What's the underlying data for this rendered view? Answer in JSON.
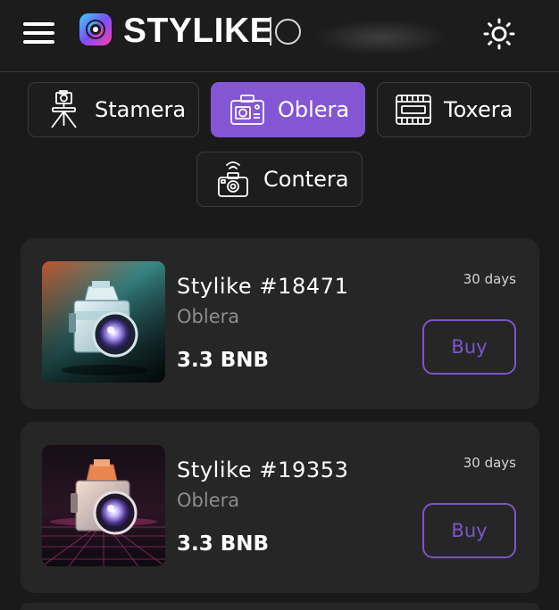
{
  "header": {
    "logo_text": "STYLIKE",
    "logo_suffix": "IO",
    "menu_icon": "hamburger-menu-icon",
    "theme_icon": "sun-icon"
  },
  "categories": [
    {
      "label": "Stamera",
      "icon": "tripod-camera-icon",
      "active": false
    },
    {
      "label": "Oblera",
      "icon": "camera-body-icon",
      "active": true
    },
    {
      "label": "Toxera",
      "icon": "lens-icon",
      "active": false
    },
    {
      "label": "Contera",
      "icon": "wireless-camera-icon",
      "active": false
    }
  ],
  "listings": [
    {
      "title": "Stylike #18471",
      "type": "Oblera",
      "price": "3.3 BNB",
      "duration": "30 days",
      "buy_label": "Buy"
    },
    {
      "title": "Stylike #19353",
      "type": "Oblera",
      "price": "3.3 BNB",
      "duration": "30 days",
      "buy_label": "Buy"
    }
  ],
  "colors": {
    "accent": "#8556d4",
    "background": "#1a1a1b",
    "card": "#262627"
  }
}
